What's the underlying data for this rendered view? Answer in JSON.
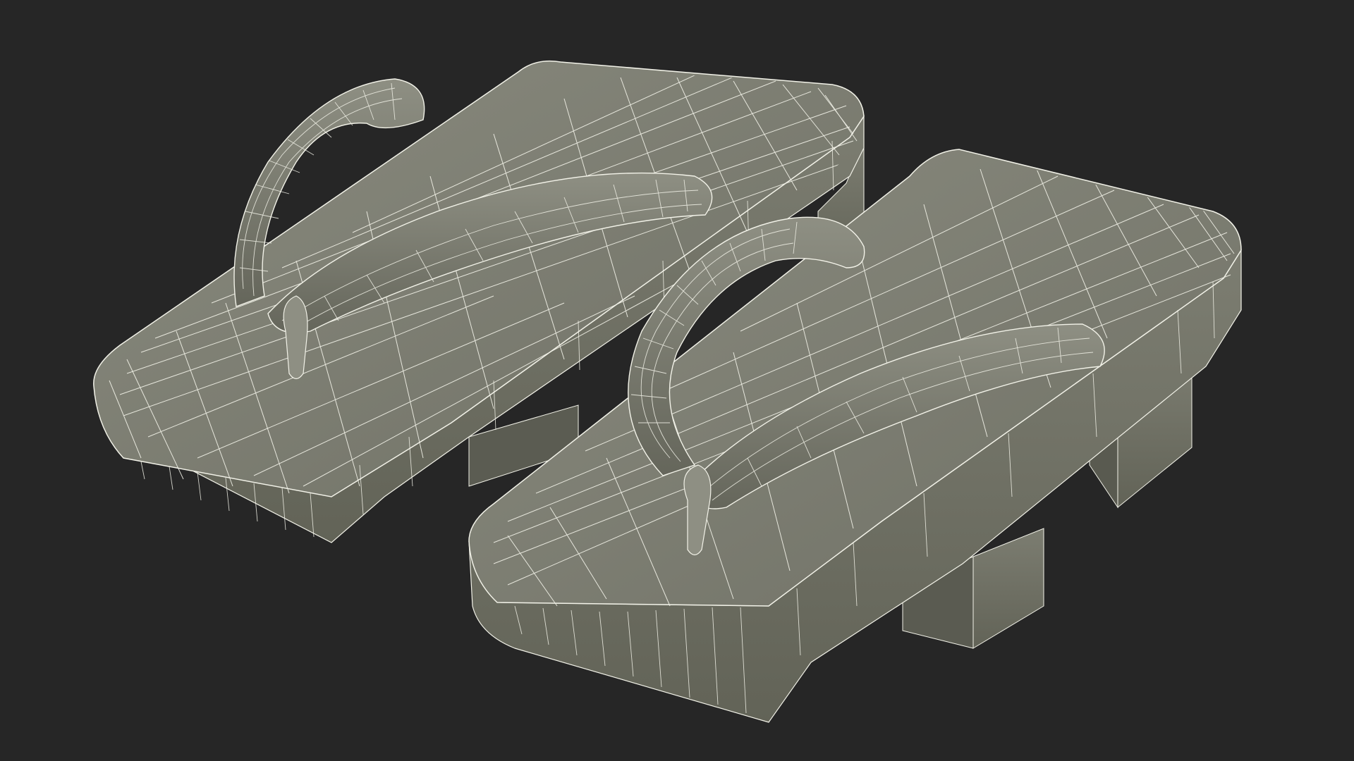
{
  "scene": {
    "subject": "wireframe-render",
    "background_color": "#262626",
    "surface_color": "#7b7c70",
    "shadow_color": "#5f6055",
    "highlight_color": "#8e8f83",
    "wire_color": "#f2f2e8"
  }
}
